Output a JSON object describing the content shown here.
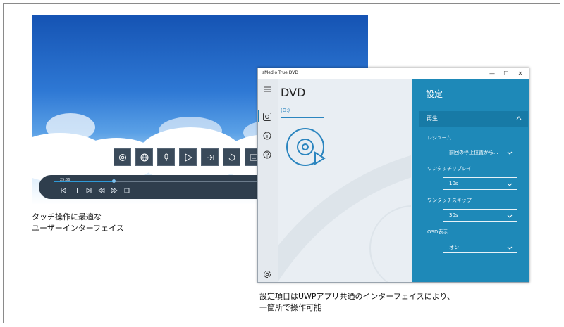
{
  "video": {
    "time": "25:36",
    "touch_buttons": [
      "settings-icon",
      "globe-icon",
      "microphone-icon",
      "play-icon",
      "skip-icon",
      "replay-icon",
      "subtitles-icon"
    ],
    "controls": [
      "skip-start-icon",
      "pause-icon",
      "skip-end-icon",
      "rewind-icon",
      "forward-icon",
      "stop-icon"
    ],
    "progress": 0.18
  },
  "captions": {
    "left_line1": "タッチ操作に最適な",
    "left_line2": "ユーザーインターフェイス",
    "right_line1": "設定項目はUWPアプリ共通のインターフェイスにより、",
    "right_line2": "一箇所で操作可能"
  },
  "window": {
    "title": "sMedio True DVD",
    "minimize": "—",
    "maximize": "☐",
    "close": "✕"
  },
  "main": {
    "title": "DVD",
    "drive_tab": "(D:)"
  },
  "settings": {
    "title": "設定",
    "section": "再生",
    "items": [
      {
        "label": "レジューム",
        "value": "前回の停止位置から..."
      },
      {
        "label": "ワンタッチリプレイ",
        "value": "10s"
      },
      {
        "label": "ワンタッチスキップ",
        "value": "30s"
      },
      {
        "label": "OSD表示",
        "value": "オン"
      }
    ]
  },
  "colors": {
    "accent": "#1e89b8",
    "section": "#177aa6",
    "seek": "#2f9ad8"
  }
}
